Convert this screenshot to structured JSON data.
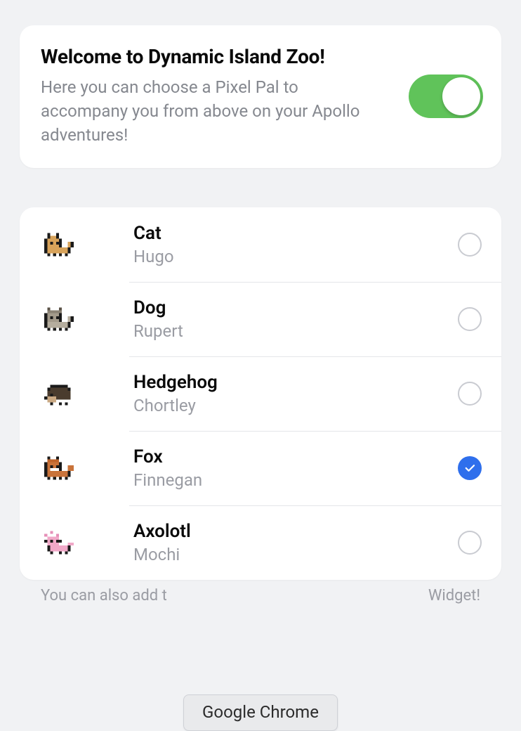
{
  "hero": {
    "title": "Welcome to Dynamic Island Zoo!",
    "subtitle": "Here you can choose a Pixel Pal to accompany you from above on your Apollo adventures!",
    "toggle_on": true
  },
  "pals": [
    {
      "species": "Cat",
      "name": "Hugo",
      "selected": false,
      "icon": "cat"
    },
    {
      "species": "Dog",
      "name": "Rupert",
      "selected": false,
      "icon": "dog"
    },
    {
      "species": "Hedgehog",
      "name": "Chortley",
      "selected": false,
      "icon": "hedgehog"
    },
    {
      "species": "Fox",
      "name": "Finnegan",
      "selected": true,
      "icon": "fox"
    },
    {
      "species": "Axolotl",
      "name": "Mochi",
      "selected": false,
      "icon": "axolotl"
    }
  ],
  "hint": {
    "left_fragment": "You can also add t",
    "right_fragment": "Widget!"
  },
  "overlay": {
    "app_pill": "Google Chrome"
  },
  "colors": {
    "toggle_on": "#60c35a",
    "accent_blue": "#2f6fec",
    "background": "#f1f2f4"
  }
}
